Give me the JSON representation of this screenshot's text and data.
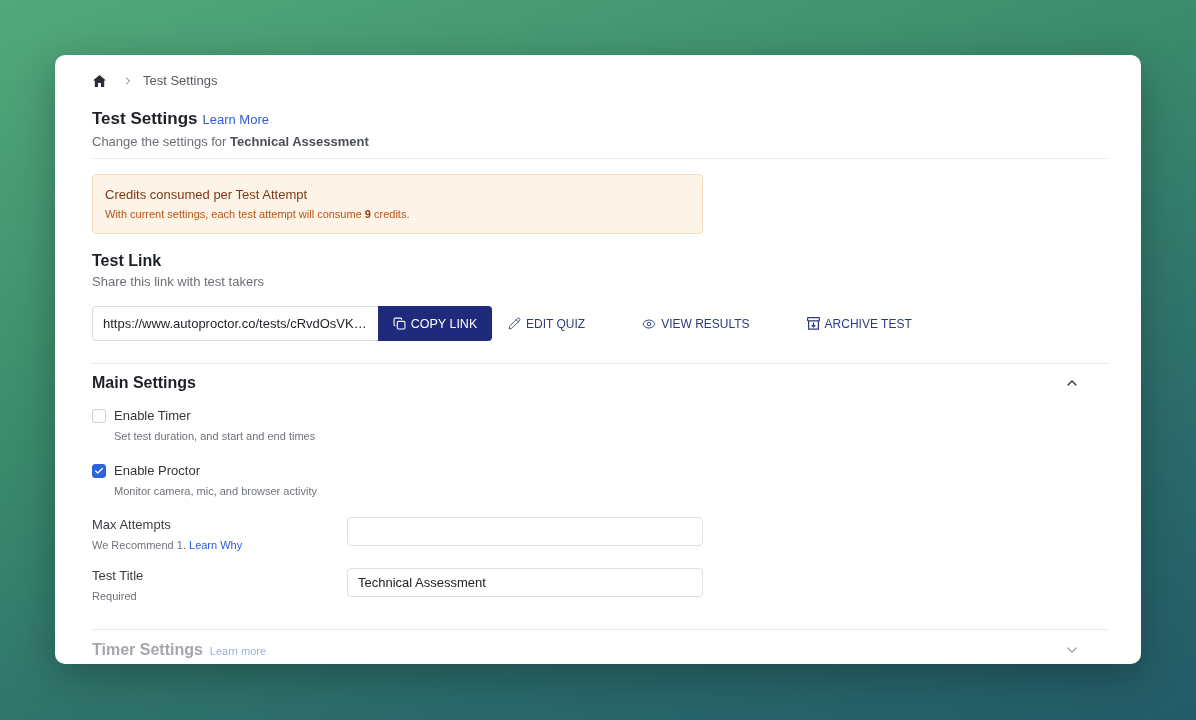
{
  "breadcrumb": {
    "current": "Test Settings"
  },
  "header": {
    "title": "Test Settings",
    "link": "Learn More",
    "subtitle": "Change the settings for **Technical Assessment**"
  },
  "credits_notice": {
    "title": "Credits consumed per Test Attempt",
    "text": "With current settings, each test attempt will consume **9** credits."
  },
  "test_link": {
    "title": "Test Link",
    "subtitle": "Share this link with test takers",
    "url": "https://www.autoproctor.co/tests/cRvdOsVK…",
    "actions": [
      {
        "kind": "copy",
        "label": "COPY LINK"
      },
      {
        "kind": "edit",
        "label": "EDIT QUIZ"
      },
      {
        "kind": "view",
        "label": "VIEW RESULTS"
      },
      {
        "kind": "archive",
        "label": "ARCHIVE TEST"
      }
    ]
  },
  "sections": [
    {
      "title": "Main Settings",
      "expanded": true,
      "disabled": false,
      "options": [
        {
          "label": "Enable Timer",
          "description": "Set test duration, and start and end times",
          "checked": false
        },
        {
          "label": "Enable Proctor",
          "description": "Monitor camera, mic, and browser activity",
          "checked": true
        }
      ],
      "fields": [
        {
          "label": "Max Attempts",
          "hint": "We Recommend 1.",
          "hint_link": "Learn Why"
        },
        {
          "label": "Test Title",
          "hint": "Required",
          "value": "Technical Assessment"
        }
      ]
    },
    {
      "title": "Timer Settings",
      "link": "Learn more",
      "expanded": false,
      "disabled": true
    }
  ]
}
